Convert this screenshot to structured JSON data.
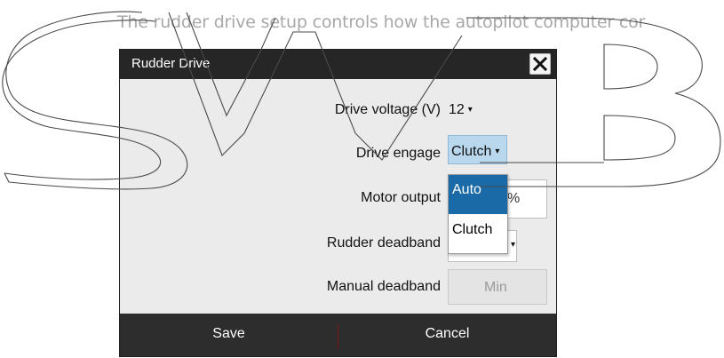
{
  "manual": {
    "intro_text": "The rudder drive setup controls how the autopilot computer cor"
  },
  "dialog": {
    "title": "Rudder Drive",
    "rows": [
      {
        "label": "Drive voltage (V)",
        "value": "12"
      },
      {
        "label": "Drive engage",
        "value": "Clutch"
      },
      {
        "label": "Motor output",
        "value": "%"
      },
      {
        "label": "Rudder deadband",
        "value": ""
      },
      {
        "label": "Manual deadband",
        "value": "Min"
      }
    ],
    "dropdown_options": [
      "Auto",
      "Clutch"
    ],
    "dropdown_selected": "Auto",
    "footer": {
      "save_label": "Save",
      "cancel_label": "Cancel"
    }
  },
  "colors": {
    "titlebar": "#262626",
    "selected_option": "#1a6aa8",
    "engage_combo_highlight": "#b9d8ee",
    "footer": "#2d2d2d"
  },
  "icons": {
    "close": "close-x-icon",
    "caret": "caret-down-icon"
  }
}
